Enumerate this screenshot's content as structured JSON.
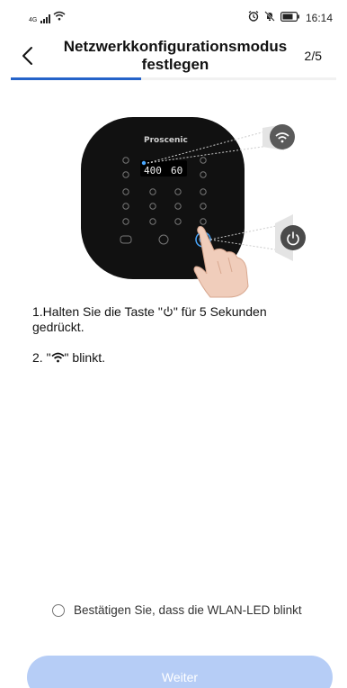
{
  "status": {
    "network_label": "4G",
    "time": "16:14",
    "icons": [
      "signal-icon",
      "wifi-icon",
      "alarm-icon",
      "mute-icon",
      "battery-icon"
    ]
  },
  "header": {
    "title": "Netzwerkkonfigurationsmodus festlegen",
    "step": "2/5",
    "progress": 0.4
  },
  "device": {
    "brand": "Proscenic",
    "display_left": "400",
    "display_right": "60"
  },
  "instructions": {
    "step1_prefix": "1.Halten Sie die Taste \"",
    "step1_suffix": "\" für 5 Sekunden gedrückt.",
    "step2_prefix": "2. \"",
    "step2_suffix": "\" blinkt."
  },
  "confirm": {
    "label": "Bestätigen Sie, dass die WLAN-LED blinkt",
    "checked": false
  },
  "next_button": {
    "label": "Weiter"
  },
  "colors": {
    "accent": "#2563c9",
    "button_disabled": "#b6cdf6",
    "device_body": "#111111",
    "callout": "#5a5a5a"
  }
}
